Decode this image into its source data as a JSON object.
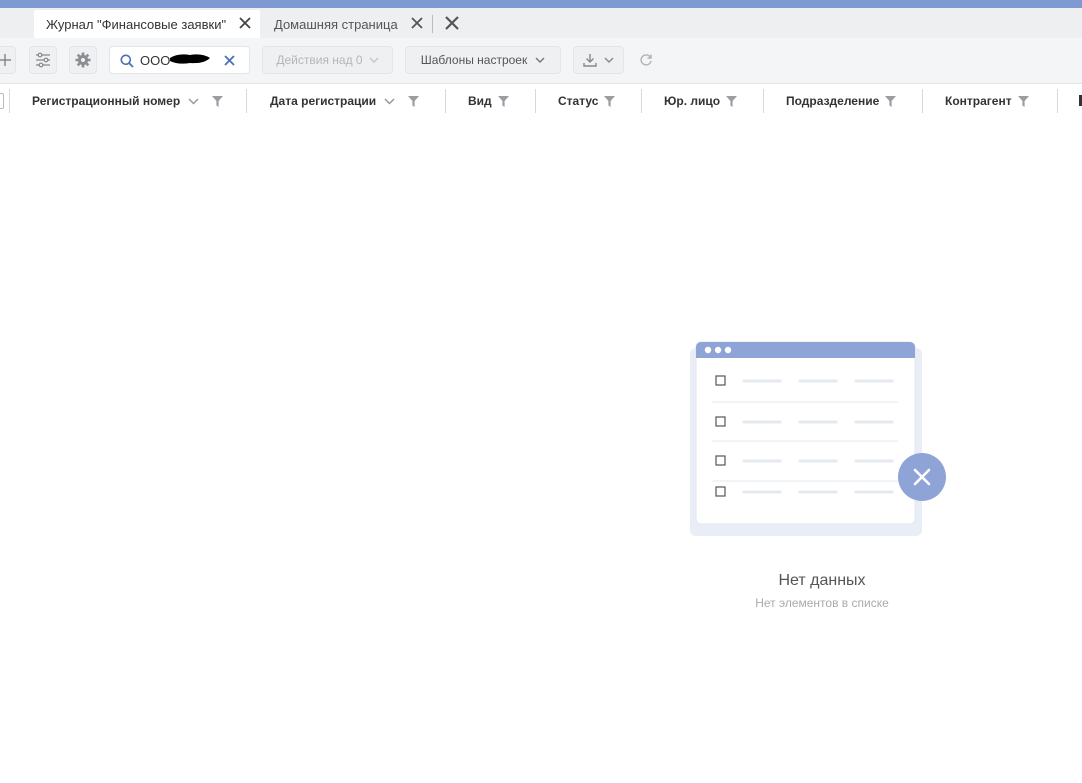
{
  "tabs": {
    "active_label": "Журнал \"Финансовые заявки\"",
    "inactive_label": "Домашняя страница"
  },
  "toolbar": {
    "search_value": "ООО",
    "actions_label": "Действия над 0",
    "templates_label": "Шаблоны настроек"
  },
  "columns": [
    "Регистрационный номер",
    "Дата регистрации",
    "Вид",
    "Статус",
    "Юр. лицо",
    "Подразделение",
    "Контрагент"
  ],
  "empty_state": {
    "title": "Нет данных",
    "subtitle": "Нет элементов в списке"
  },
  "colors": {
    "accent": "#7f9ad3",
    "toolbar_bg": "#f4f5f7",
    "tab_bar_bg": "#eeeff1"
  },
  "icons": [
    "plus-icon",
    "filter-settings-icon",
    "gear-icon",
    "search-icon",
    "clear-icon",
    "chevron-down-icon",
    "download-icon",
    "refresh-icon",
    "close-icon",
    "funnel-icon"
  ]
}
